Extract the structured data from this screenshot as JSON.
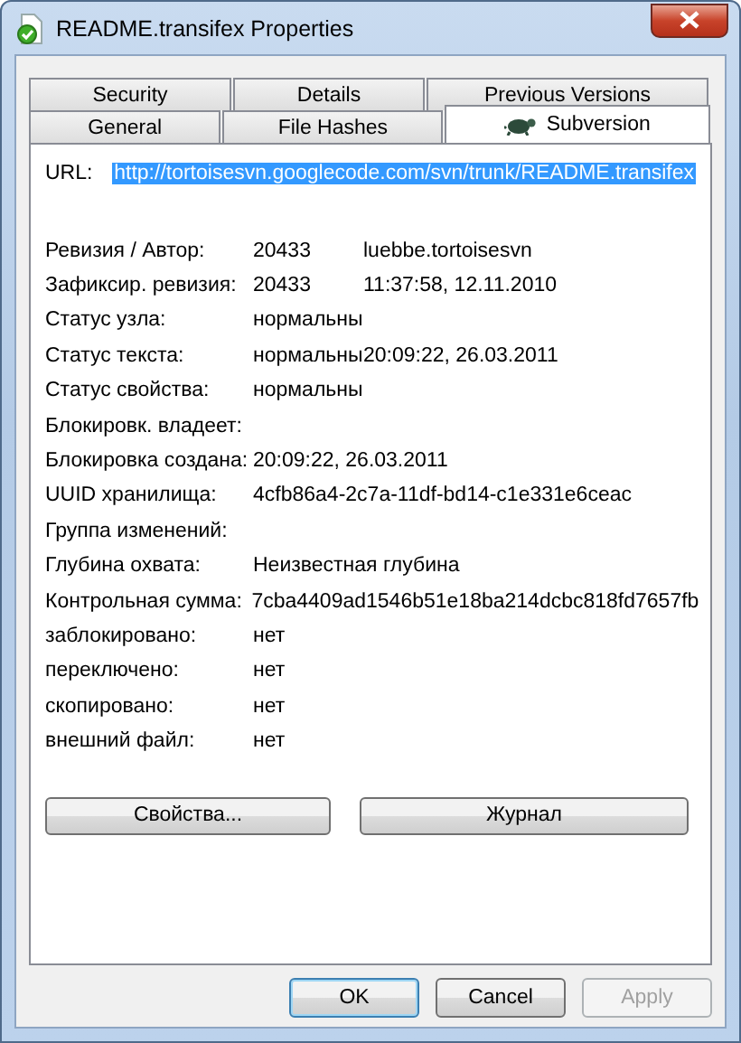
{
  "window": {
    "title": "README.transifex Properties"
  },
  "tab_rows": [
    {
      "tabs": [
        {
          "label": "Security",
          "selected": false
        },
        {
          "label": "Details",
          "selected": false
        },
        {
          "label": "Previous Versions",
          "selected": false
        }
      ]
    },
    {
      "tabs": [
        {
          "label": "General",
          "selected": false
        },
        {
          "label": "File Hashes",
          "selected": false
        },
        {
          "label": "Subversion",
          "selected": true
        }
      ]
    }
  ],
  "url": {
    "label": "URL:",
    "value": "http://tortoisesvn.googlecode.com/svn/trunk/README.transifex",
    "selected": true
  },
  "fields": [
    {
      "label": "Ревизия / Автор:",
      "values": [
        "20433",
        "luebbe.tortoisesvn"
      ]
    },
    {
      "label": "Зафиксир. ревизия:",
      "values": [
        "20433",
        "11:37:58, 12.11.2010"
      ]
    },
    {
      "label": "Статус узла:",
      "values": [
        "нормальны"
      ]
    },
    {
      "label": "Статус текста:",
      "values": [
        "нормальны",
        "20:09:22, 26.03.2011"
      ]
    },
    {
      "label": "Статус свойства:",
      "values": [
        "нормальны"
      ]
    },
    {
      "label": "Блокировк. владеет:"
    },
    {
      "label": "Блокировка создана:",
      "values": [
        "20:09:22, 26.03.2011"
      ]
    },
    {
      "label": "UUID хранилища:",
      "values": [
        "4cfb86a4-2c7a-11df-bd14-c1e331e6ceac"
      ]
    },
    {
      "label": "Группа изменений:"
    },
    {
      "label": "Глубина охвата:",
      "values": [
        "Неизвестная глубина"
      ]
    },
    {
      "label": "Контрольная сумма:",
      "values": [
        "7cba4409ad1546b51e18ba214dcbc818fd7657fb"
      ]
    },
    {
      "label": "заблокировано:",
      "values": [
        "нет"
      ]
    },
    {
      "label": "переключено:",
      "values": [
        "нет"
      ]
    },
    {
      "label": "скопировано:",
      "values": [
        "нет"
      ]
    },
    {
      "label": "внешний файл:",
      "values": [
        "нет"
      ]
    }
  ],
  "actions": [
    {
      "label": "Свойства..."
    },
    {
      "label": "Журнал"
    }
  ],
  "dialog_buttons": [
    {
      "label": "OK",
      "default": true,
      "disabled": false
    },
    {
      "label": "Cancel",
      "default": false,
      "disabled": false
    },
    {
      "label": "Apply",
      "default": false,
      "disabled": true
    }
  ]
}
